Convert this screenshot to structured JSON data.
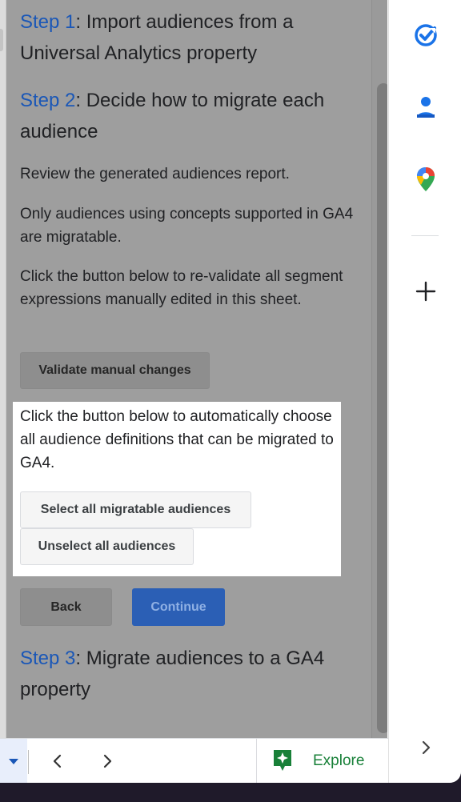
{
  "steps": {
    "step1": {
      "link": "Step 1",
      "text": ": Import audiences from a Universal Analytics property"
    },
    "step2": {
      "link": "Step 2",
      "text": ": Decide how to migrate each audience"
    },
    "step3": {
      "link": "Step 3",
      "text": ": Migrate audiences to a GA4 property"
    }
  },
  "body": {
    "review": "Review the generated audiences report.",
    "only": "Only audiences using concepts supported in GA4 are migratable.",
    "revalidate": "Click the button below to re-validate all segment expressions manually edited in this sheet.",
    "auto_choose": "Click the button below to automatically choose all audience definitions that can be migrated to GA4."
  },
  "buttons": {
    "validate": "Validate manual changes",
    "select_all": "Select all migratable audiences",
    "unselect_all": "Unselect all audiences",
    "back": "Back",
    "continue": "Continue"
  },
  "bottom_bar": {
    "explore": "Explore"
  },
  "side_rail": {
    "icons": [
      "tasks-icon",
      "contacts-icon",
      "maps-icon",
      "add-icon"
    ]
  },
  "colors": {
    "step_link": "#1a57b7",
    "continue_button": "#2b5fb5",
    "explore_green": "#188038",
    "tasks_blue": "#1a73e8"
  }
}
